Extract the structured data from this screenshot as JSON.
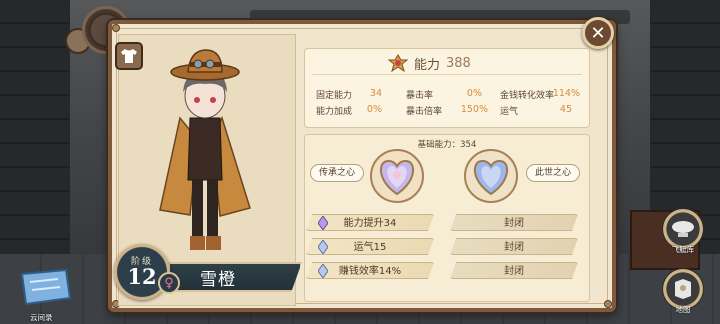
{
  "header": {
    "close_symbol": "✕"
  },
  "character": {
    "stage_label": "阶级",
    "stage_number": "12",
    "name": "雪橙",
    "gender_symbol": "♀"
  },
  "power": {
    "label": "能力",
    "value": "388"
  },
  "stats": [
    {
      "label": "固定能力",
      "value": "34"
    },
    {
      "label": "暴击率",
      "value": "0%"
    },
    {
      "label": "金钱转化效率",
      "value": "114%"
    },
    {
      "label": "能力加成",
      "value": "0%"
    },
    {
      "label": "暴击倍率",
      "value": "150%"
    },
    {
      "label": "运气",
      "value": "45"
    }
  ],
  "legacy": {
    "base_power": "基础能力：354",
    "inherit_label": "传承之心",
    "current_label": "此世之心",
    "left_slots": [
      {
        "text": "能力提升34",
        "gem": "purple"
      },
      {
        "text": "运气15",
        "gem": "blue"
      },
      {
        "text": "赚钱效率14%",
        "gem": "blue"
      }
    ],
    "right_slots": [
      {
        "text": "封闭"
      },
      {
        "text": "封闭"
      },
      {
        "text": "封闭"
      }
    ]
  },
  "side_controls": {
    "airship_label": "飞艇库",
    "map_label": "地图",
    "cloud_map_label": "云间录"
  },
  "colors": {
    "panel_bg": "#f1e6cd",
    "panel_border": "#7b5a3d",
    "stat_value": "#d98a3a",
    "name_plate": "#2f3f48"
  }
}
